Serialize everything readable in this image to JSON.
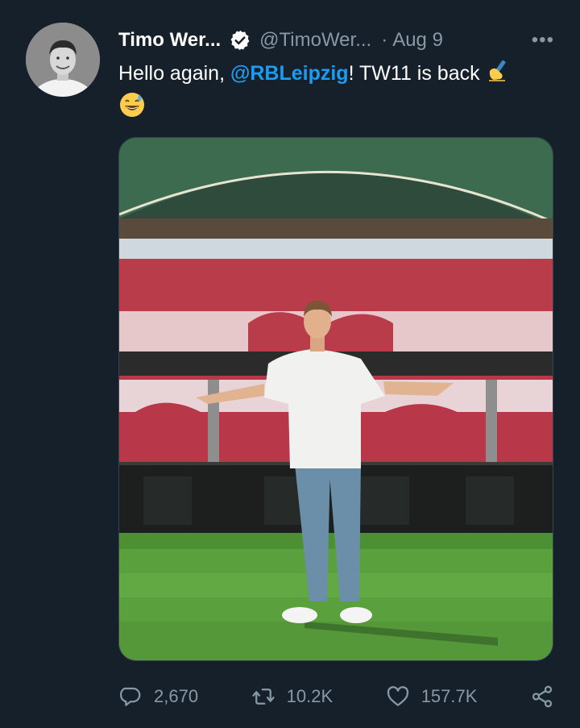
{
  "tweet": {
    "author_name": "Timo Wer...",
    "author_handle": "@TimoWer...",
    "date_separator": "·",
    "date": "Aug 9",
    "more_label": "•••",
    "text_before": "Hello again, ",
    "mention": "@RBLeipzig",
    "text_after": "! TW11 is back ",
    "emoji_writing": "writing-hand-emoji",
    "emoji_sweat": "grinning-sweat-emoji"
  },
  "actions": {
    "replies": "2,670",
    "retweets": "10.2K",
    "likes": "157.7K"
  },
  "icons": {
    "reply": "reply-icon",
    "retweet": "retweet-icon",
    "like": "heart-icon",
    "share": "share-icon",
    "verified": "verified-badge-icon"
  },
  "colors": {
    "background": "#15202b",
    "link": "#1d9bf0",
    "secondary_text": "#8899a6"
  }
}
